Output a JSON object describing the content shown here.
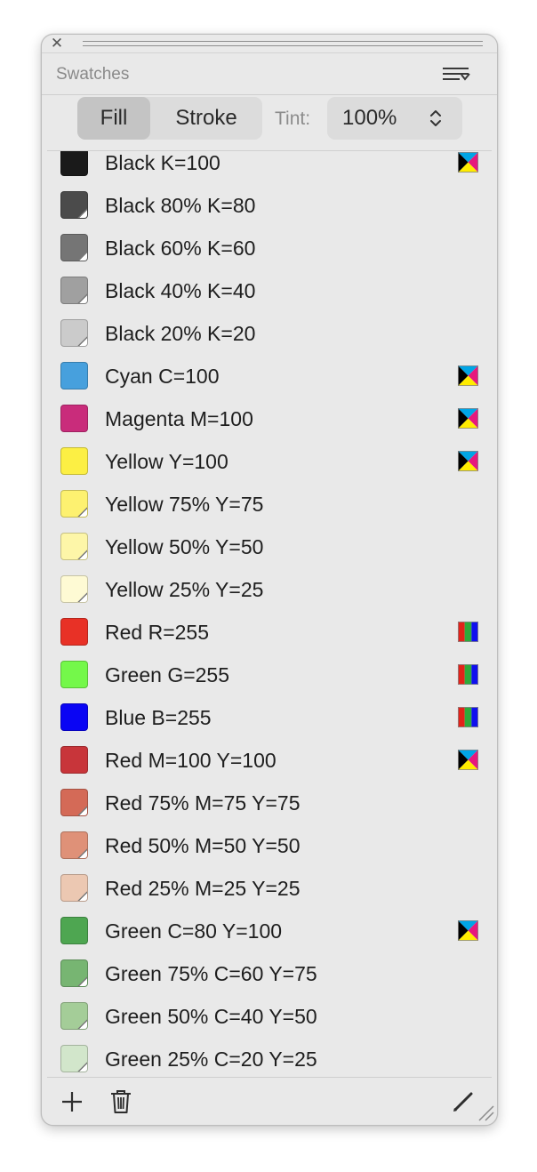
{
  "panel": {
    "title": "Swatches",
    "close_symbol": "✕"
  },
  "controls": {
    "fill_label": "Fill",
    "stroke_label": "Stroke",
    "active": "Fill",
    "tint_label": "Tint:",
    "tint_value": "100%"
  },
  "swatches": [
    {
      "name": "Black K=100",
      "color": "#1a1a1a",
      "tint": false,
      "mode": "cmyk"
    },
    {
      "name": "Black 80% K=80",
      "color": "#4b4b4b",
      "tint": true,
      "mode": ""
    },
    {
      "name": "Black 60% K=60",
      "color": "#757575",
      "tint": true,
      "mode": ""
    },
    {
      "name": "Black 40% K=40",
      "color": "#a0a0a0",
      "tint": true,
      "mode": ""
    },
    {
      "name": "Black 20% K=20",
      "color": "#cbcbcb",
      "tint": true,
      "mode": ""
    },
    {
      "name": "Cyan C=100",
      "color": "#47a0dd",
      "tint": false,
      "mode": "cmyk"
    },
    {
      "name": "Magenta M=100",
      "color": "#c92c7b",
      "tint": false,
      "mode": "cmyk"
    },
    {
      "name": "Yellow Y=100",
      "color": "#fcef44",
      "tint": false,
      "mode": "cmyk"
    },
    {
      "name": "Yellow 75% Y=75",
      "color": "#fdf170",
      "tint": true,
      "mode": ""
    },
    {
      "name": "Yellow 50% Y=50",
      "color": "#fdf6a8",
      "tint": true,
      "mode": ""
    },
    {
      "name": "Yellow 25% Y=25",
      "color": "#fefad4",
      "tint": true,
      "mode": ""
    },
    {
      "name": "Red R=255",
      "color": "#e83126",
      "tint": false,
      "mode": "rgb"
    },
    {
      "name": "Green G=255",
      "color": "#74f84a",
      "tint": false,
      "mode": "rgb"
    },
    {
      "name": "Blue B=255",
      "color": "#0a05f4",
      "tint": false,
      "mode": "rgb"
    },
    {
      "name": "Red M=100 Y=100",
      "color": "#c8353a",
      "tint": false,
      "mode": "cmyk"
    },
    {
      "name": "Red 75% M=75 Y=75",
      "color": "#d46a57",
      "tint": true,
      "mode": ""
    },
    {
      "name": "Red 50% M=50 Y=50",
      "color": "#df9178",
      "tint": true,
      "mode": ""
    },
    {
      "name": "Red 25% M=25 Y=25",
      "color": "#ecc8b2",
      "tint": true,
      "mode": ""
    },
    {
      "name": "Green C=80 Y=100",
      "color": "#4ea651",
      "tint": false,
      "mode": "cmyk"
    },
    {
      "name": "Green 75% C=60 Y=75",
      "color": "#77b572",
      "tint": true,
      "mode": ""
    },
    {
      "name": "Green 50% C=40 Y=50",
      "color": "#a4cd98",
      "tint": true,
      "mode": ""
    },
    {
      "name": "Green 25% C=20 Y=25",
      "color": "#d2e6cb",
      "tint": true,
      "mode": ""
    }
  ],
  "icons": {
    "close": "close-icon",
    "menu": "panel-menu-icon",
    "stepper": "up-down-chevron-icon",
    "cmyk": "cmyk-process-icon",
    "rgb": "rgb-icon",
    "add": "plus-icon",
    "delete": "trash-icon",
    "edit": "pencil-icon",
    "resize": "resize-grip-icon"
  }
}
